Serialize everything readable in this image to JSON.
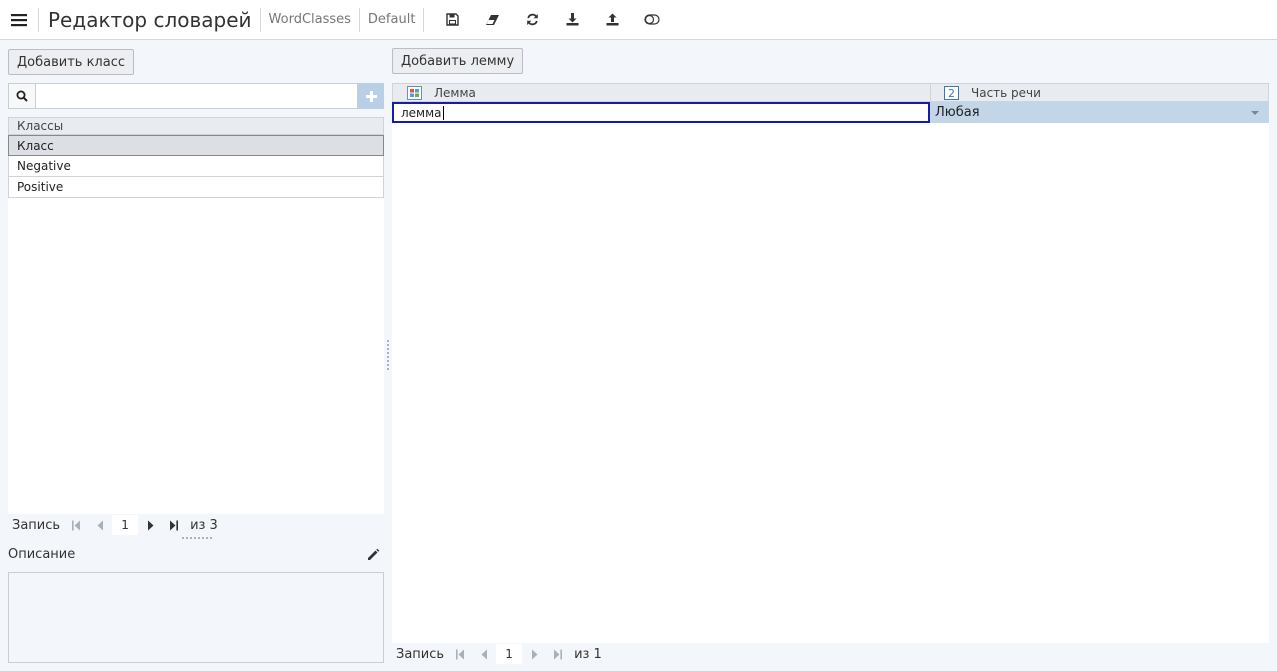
{
  "header": {
    "title": "Редактор словарей",
    "crumbs": [
      "WordClasses",
      "Default"
    ]
  },
  "toolbar": {
    "icons": [
      "save-icon",
      "eraser-icon",
      "refresh-icon",
      "download-icon",
      "upload-icon",
      "toggle-icon"
    ]
  },
  "classes": {
    "add_button": "Добавить класс",
    "search_value": "",
    "header": "Классы",
    "items": [
      {
        "label": "Класс",
        "selected": true
      },
      {
        "label": "Negative",
        "selected": false
      },
      {
        "label": "Positive",
        "selected": false
      }
    ],
    "pager": {
      "label": "Запись",
      "current": "1",
      "of": "из 3"
    }
  },
  "description": {
    "label": "Описание",
    "value": ""
  },
  "lemmas": {
    "add_button": "Добавить лемму",
    "columns": [
      {
        "label": "Лемма",
        "icon": "grid-icon"
      },
      {
        "label": "Часть речи",
        "icon": "number-2-icon",
        "icon_text": "2"
      }
    ],
    "rows": [
      {
        "lemma": "лемма",
        "pos": "Любая"
      }
    ],
    "pager": {
      "label": "Запись",
      "current": "1",
      "of": "из 1"
    }
  },
  "colors": {
    "accent": "#1a1aa8",
    "row_highlight": "#c3d6e8",
    "add_button_bg": "#b8cfe6",
    "background": "#f3f6fa"
  }
}
